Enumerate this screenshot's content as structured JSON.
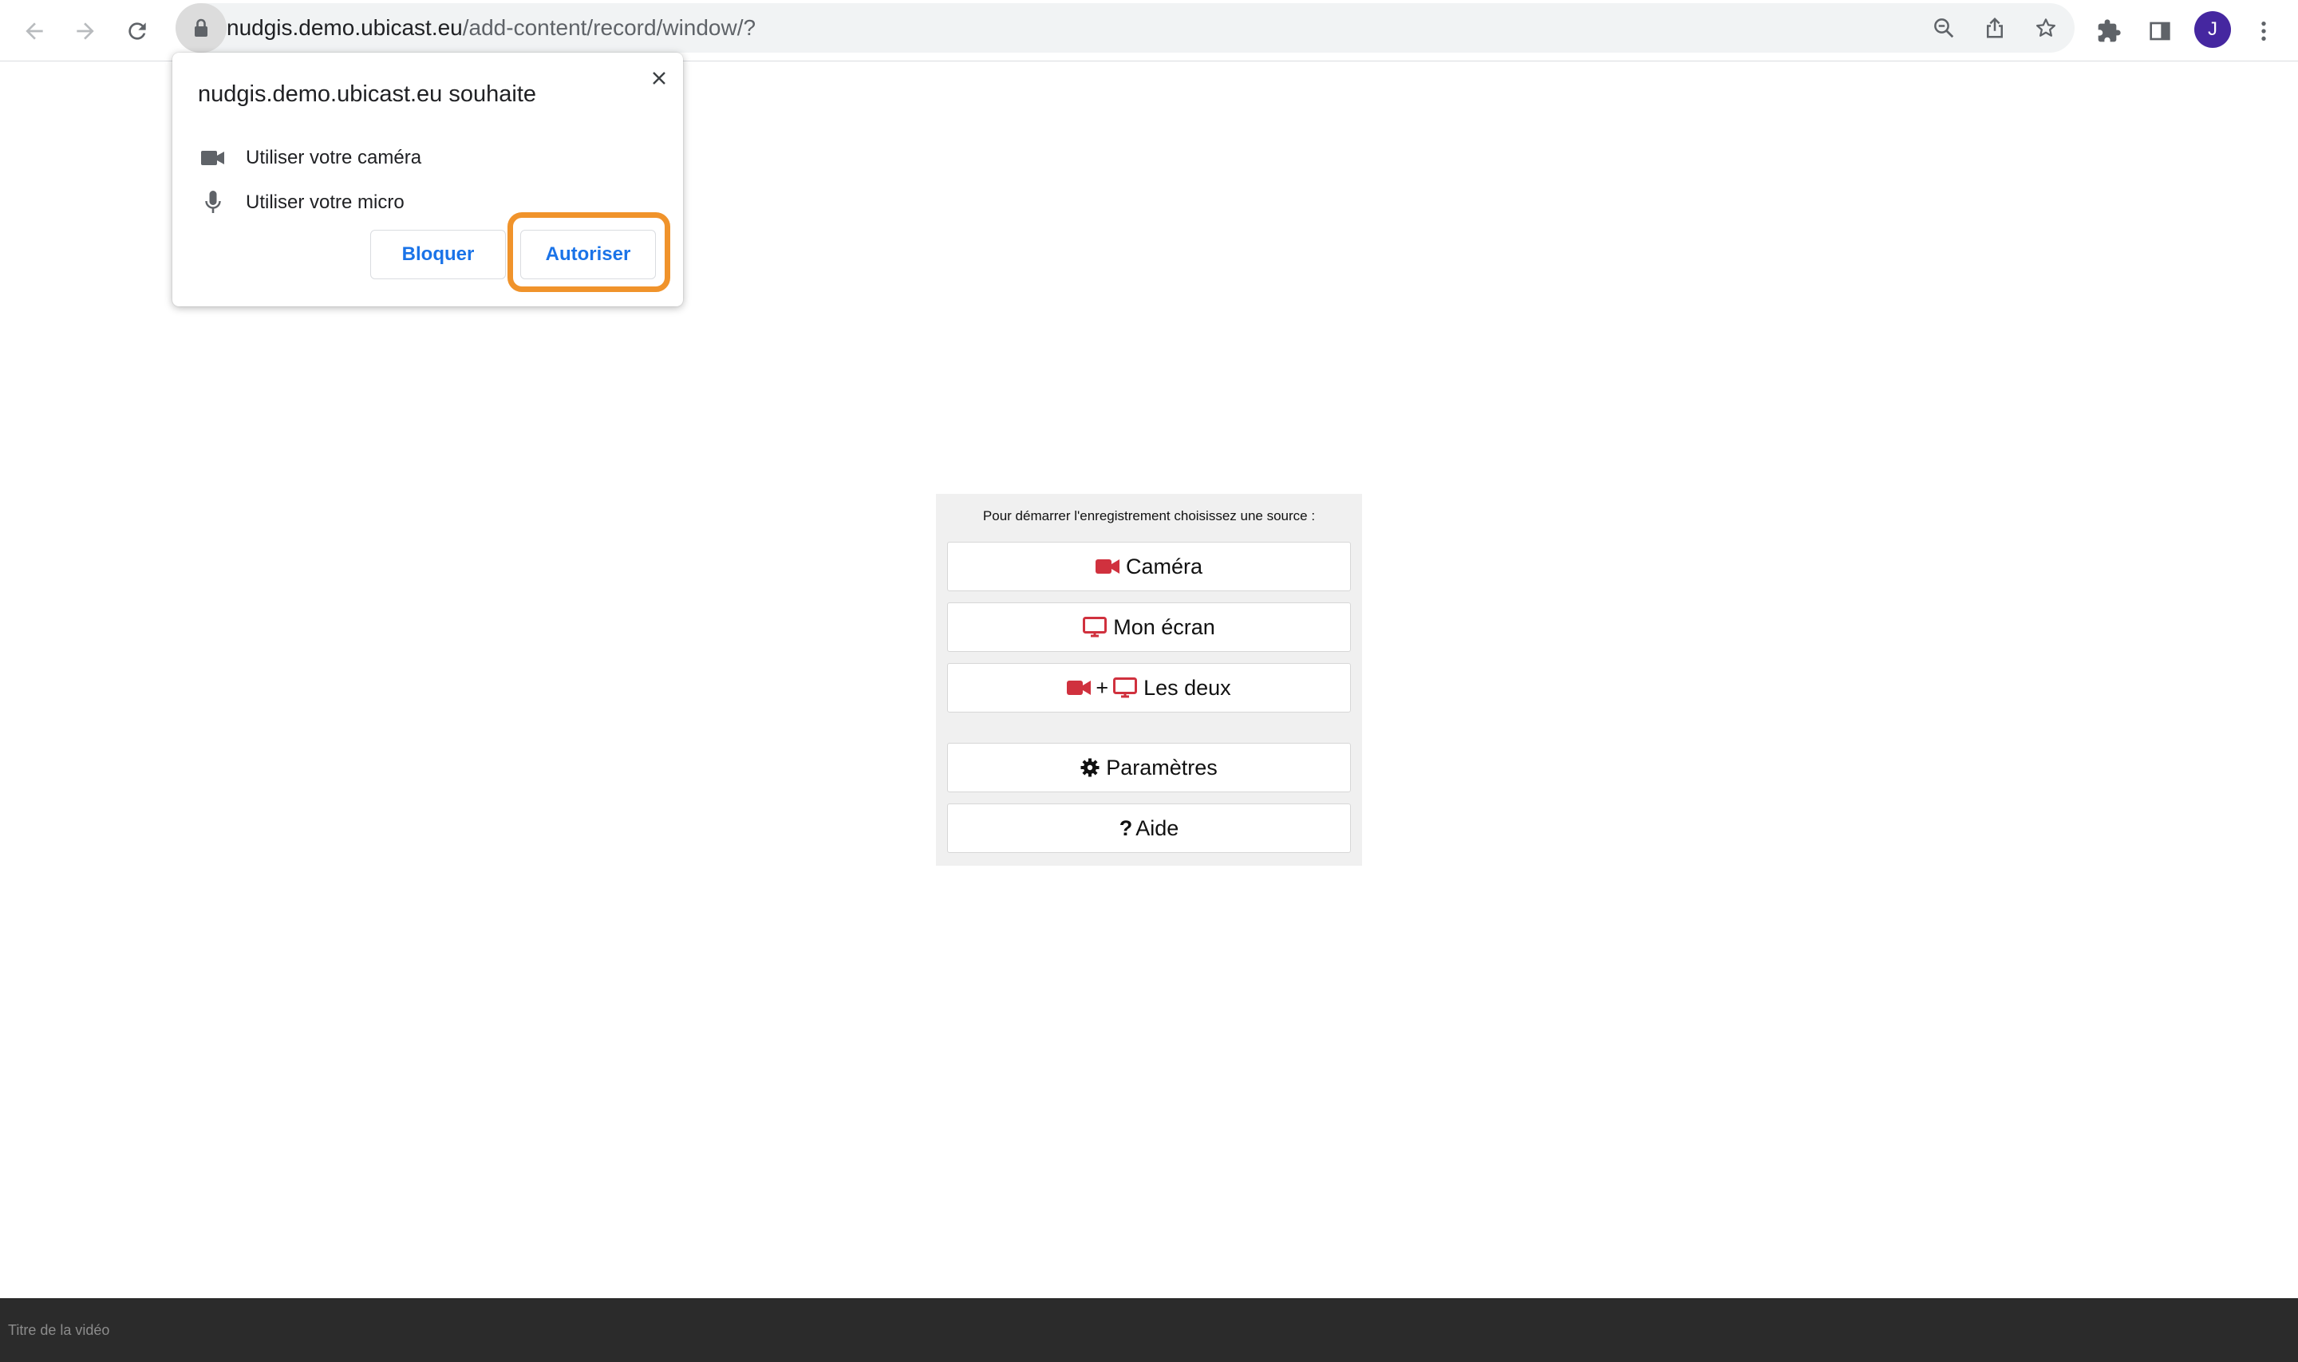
{
  "browser": {
    "url_host": "nudgis.demo.ubicast.eu",
    "url_path": "/add-content/record/window/?",
    "profile_initial": "J",
    "icons": [
      "back-icon",
      "forward-icon",
      "reload-icon",
      "lock-icon",
      "zoom-out-icon",
      "share-icon",
      "star-icon",
      "extensions-icon",
      "side-panel-icon",
      "more-menu-icon"
    ]
  },
  "permission_popup": {
    "title": "nudgis.demo.ubicast.eu souhaite",
    "items": [
      {
        "icon": "camera-icon",
        "label": "Utiliser votre caméra"
      },
      {
        "icon": "microphone-icon",
        "label": "Utiliser votre micro"
      }
    ],
    "block_label": "Bloquer",
    "allow_label": "Autoriser",
    "highlight_color": "#f0932b"
  },
  "recorder": {
    "prompt": "Pour démarrer l'enregistrement choisissez une source :",
    "camera_label": "Caméra",
    "screen_label": "Mon écran",
    "plus": "+",
    "both_label": "Les deux",
    "settings_label": "Paramètres",
    "help_glyph": "?",
    "help_label": "Aide",
    "icon_color": "#d0313e"
  },
  "footer": {
    "title_placeholder": "Titre de la vidéo"
  }
}
